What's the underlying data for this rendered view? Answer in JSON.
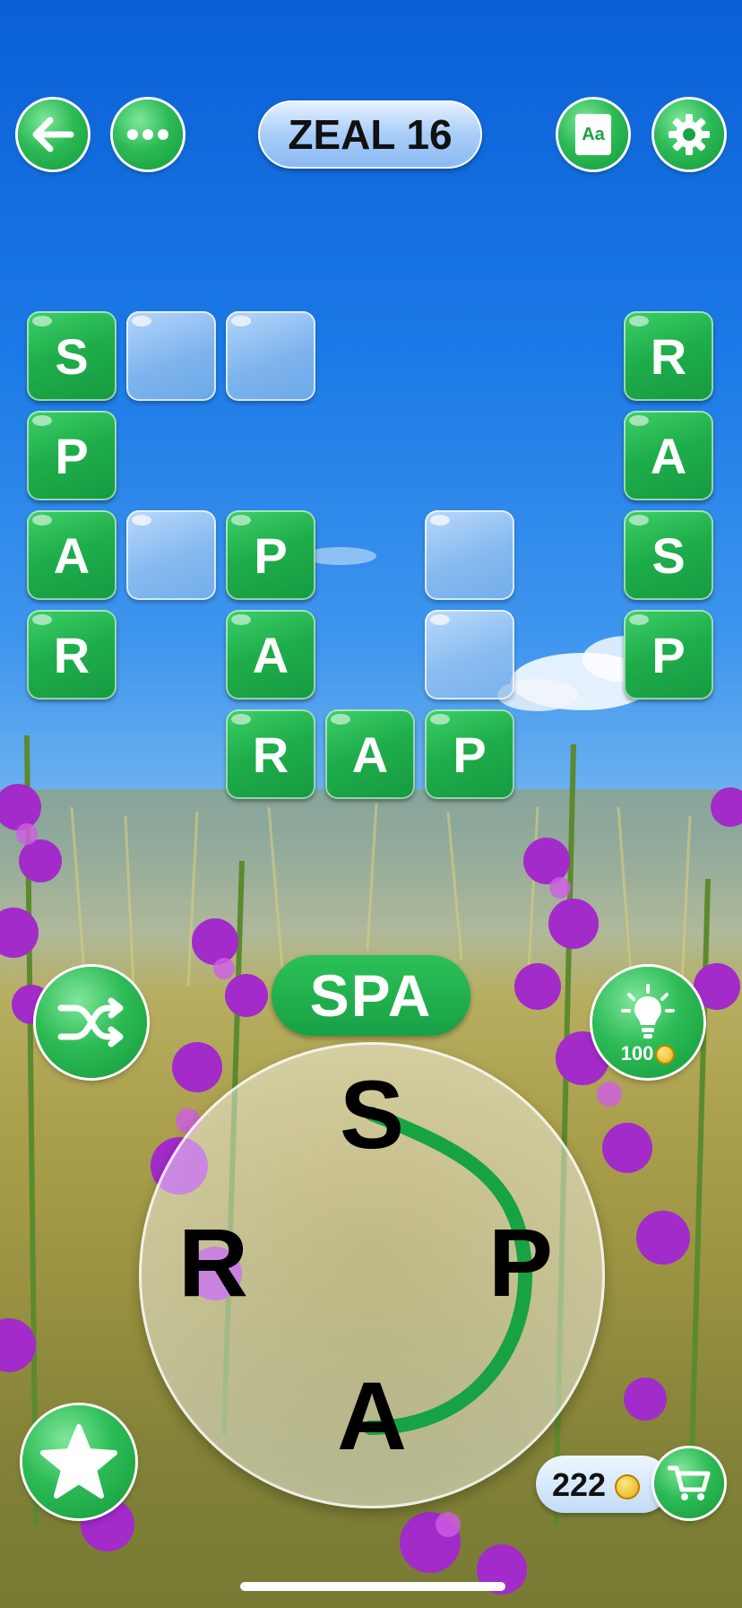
{
  "header": {
    "level_title": "ZEAL 16",
    "back_icon": "arrow-left-icon",
    "menu_icon": "more-dots-icon",
    "dictionary_icon": "dictionary-book-icon",
    "dictionary_icon_text": "Aa",
    "settings_icon": "gear-icon"
  },
  "board": {
    "tiles": [
      {
        "letter": "S",
        "state": "filled"
      },
      {
        "letter": "",
        "state": "empty"
      },
      {
        "letter": "",
        "state": "empty"
      },
      {
        "letter": "R",
        "state": "filled"
      },
      {
        "letter": "P",
        "state": "filled"
      },
      {
        "letter": "A",
        "state": "filled"
      },
      {
        "letter": "A",
        "state": "filled"
      },
      {
        "letter": "",
        "state": "empty"
      },
      {
        "letter": "P",
        "state": "filled"
      },
      {
        "letter": "",
        "state": "empty"
      },
      {
        "letter": "S",
        "state": "filled"
      },
      {
        "letter": "R",
        "state": "filled"
      },
      {
        "letter": "A",
        "state": "filled"
      },
      {
        "letter": "",
        "state": "empty"
      },
      {
        "letter": "P",
        "state": "filled"
      },
      {
        "letter": "R",
        "state": "filled"
      },
      {
        "letter": "A",
        "state": "filled"
      },
      {
        "letter": "P",
        "state": "filled"
      }
    ]
  },
  "current_word": "SPA",
  "wheel": {
    "letters": [
      "S",
      "P",
      "A",
      "R"
    ]
  },
  "controls": {
    "shuffle_icon": "shuffle-icon",
    "hint_icon": "lightbulb-icon",
    "hint_cost": "100",
    "star_icon": "star-icon",
    "coins": "222",
    "shop_icon": "shopping-cart-icon"
  },
  "colors": {
    "accent_green": "#1fae4b",
    "connector_line": "#17a244"
  }
}
